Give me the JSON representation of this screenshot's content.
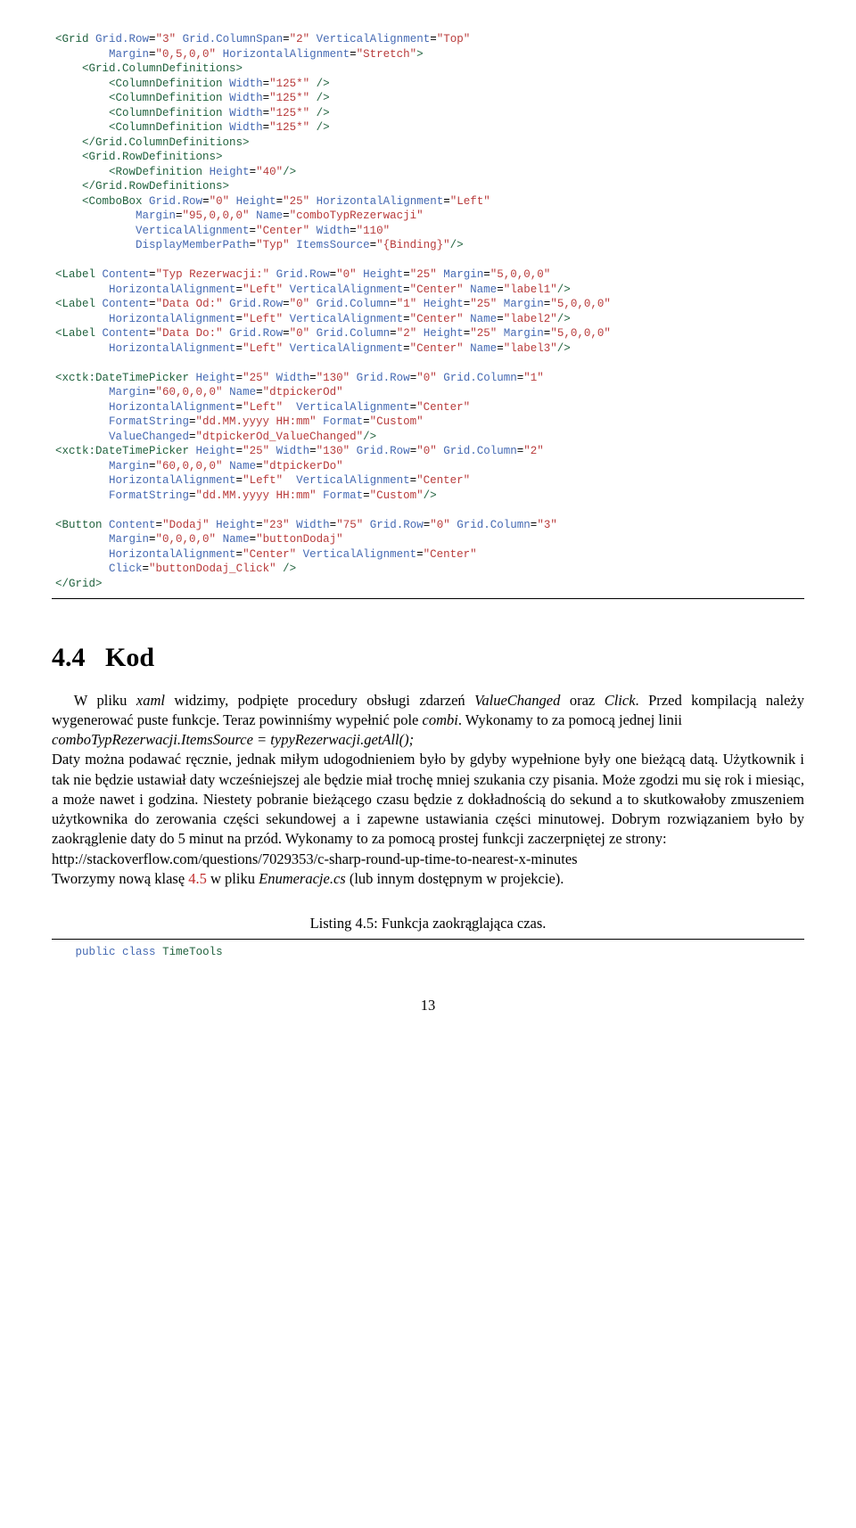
{
  "code1": {
    "l1a": "<Grid",
    "l1b": "Grid.Row",
    "l1c": "\"3\"",
    "l1d": "Grid.ColumnSpan",
    "l1e": "\"2\"",
    "l1f": "VerticalAlignment",
    "l1g": "\"Top\"",
    "l2a": "Margin",
    "l2b": "\"0,5,0,0\"",
    "l2c": "HorizontalAlignment",
    "l2d": "\"Stretch\"",
    "l2e": ">",
    "l3a": "<Grid.ColumnDefinitions>",
    "l4a": "<ColumnDefinition",
    "l4b": "Width",
    "l4c": "\"125*\"",
    "l4d": "/>",
    "l5a": "<ColumnDefinition",
    "l5b": "Width",
    "l5c": "\"125*\"",
    "l5d": "/>",
    "l6a": "<ColumnDefinition",
    "l6b": "Width",
    "l6c": "\"125*\"",
    "l6d": "/>",
    "l7a": "<ColumnDefinition",
    "l7b": "Width",
    "l7c": "\"125*\"",
    "l7d": "/>",
    "l8a": "</Grid.ColumnDefinitions>",
    "l9a": "<Grid.RowDefinitions>",
    "l10a": "<RowDefinition",
    "l10b": "Height",
    "l10c": "\"40\"",
    "l10d": "/>",
    "l11a": "</Grid.RowDefinitions>",
    "l12a": "<ComboBox",
    "l12b": "Grid.Row",
    "l12c": "\"0\"",
    "l12d": "Height",
    "l12e": "\"25\"",
    "l12f": "HorizontalAlignment",
    "l12g": "\"Left\"",
    "l13a": "Margin",
    "l13b": "\"95,0,0,0\"",
    "l13c": "Name",
    "l13d": "\"comboTypRezerwacji\"",
    "l14a": "VerticalAlignment",
    "l14b": "\"Center\"",
    "l14c": "Width",
    "l14d": "\"110\"",
    "l15a": "DisplayMemberPath",
    "l15b": "\"Typ\"",
    "l15c": "ItemsSource",
    "l15d": "\"{Binding}\"",
    "l15e": "/>",
    "l17a": "<Label",
    "l17b": "Content",
    "l17c": "\"Typ Rezerwacji:\"",
    "l17d": "Grid.Row",
    "l17e": "\"0\"",
    "l17f": "Height",
    "l17g": "\"25\"",
    "l17h": "Margin",
    "l17i": "\"5,0,0,0\"",
    "l18a": "HorizontalAlignment",
    "l18b": "\"Left\"",
    "l18c": "VerticalAlignment",
    "l18d": "\"Center\"",
    "l18e": "Name",
    "l18f": "\"label1\"",
    "l18g": "/>",
    "l19a": "<Label",
    "l19b": "Content",
    "l19c": "\"Data Od:\"",
    "l19d": "Grid.Row",
    "l19e": "\"0\"",
    "l19f": "Grid.Column",
    "l19g": "\"1\"",
    "l19h": "Height",
    "l19i": "\"25\"",
    "l19j": "Margin",
    "l19k": "\"5,0,0,0\"",
    "l20a": "HorizontalAlignment",
    "l20b": "\"Left\"",
    "l20c": "VerticalAlignment",
    "l20d": "\"Center\"",
    "l20e": "Name",
    "l20f": "\"label2\"",
    "l20g": "/>",
    "l21a": "<Label",
    "l21b": "Content",
    "l21c": "\"Data Do:\"",
    "l21d": "Grid.Row",
    "l21e": "\"0\"",
    "l21f": "Grid.Column",
    "l21g": "\"2\"",
    "l21h": "Height",
    "l21i": "\"25\"",
    "l21j": "Margin",
    "l21k": "\"5,0,0,0\"",
    "l22a": "HorizontalAlignment",
    "l22b": "\"Left\"",
    "l22c": "VerticalAlignment",
    "l22d": "\"Center\"",
    "l22e": "Name",
    "l22f": "\"label3\"",
    "l22g": "/>",
    "l24a": "<xctk:DateTimePicker",
    "l24b": "Height",
    "l24c": "\"25\"",
    "l24d": "Width",
    "l24e": "\"130\"",
    "l24f": "Grid.Row",
    "l24g": "\"0\"",
    "l24h": "Grid.Column",
    "l24i": "\"1\"",
    "l25a": "Margin",
    "l25b": "\"60,0,0,0\"",
    "l25c": "Name",
    "l25d": "\"dtpickerOd\"",
    "l26a": "HorizontalAlignment",
    "l26b": "\"Left\"",
    "l26c": "VerticalAlignment",
    "l26d": "\"Center\"",
    "l27a": "FormatString",
    "l27b": "\"dd.MM.yyyy HH:mm\"",
    "l27c": "Format",
    "l27d": "\"Custom\"",
    "l28a": "ValueChanged",
    "l28b": "\"dtpickerOd_ValueChanged\"",
    "l28c": "/>",
    "l29a": "<xctk:DateTimePicker",
    "l29b": "Height",
    "l29c": "\"25\"",
    "l29d": "Width",
    "l29e": "\"130\"",
    "l29f": "Grid.Row",
    "l29g": "\"0\"",
    "l29h": "Grid.Column",
    "l29i": "\"2\"",
    "l30a": "Margin",
    "l30b": "\"60,0,0,0\"",
    "l30c": "Name",
    "l30d": "\"dtpickerDo\"",
    "l31a": "HorizontalAlignment",
    "l31b": "\"Left\"",
    "l31c": "VerticalAlignment",
    "l31d": "\"Center\"",
    "l32a": "FormatString",
    "l32b": "\"dd.MM.yyyy HH:mm\"",
    "l32c": "Format",
    "l32d": "\"Custom\"",
    "l32e": "/>",
    "l34a": "<Button",
    "l34b": "Content",
    "l34c": "\"Dodaj\"",
    "l34d": "Height",
    "l34e": "\"23\"",
    "l34f": "Width",
    "l34g": "\"75\"",
    "l34h": "Grid.Row",
    "l34i": "\"0\"",
    "l34j": "Grid.Column",
    "l34k": "\"3\"",
    "l35a": "Margin",
    "l35b": "\"0,0,0,0\"",
    "l35c": "Name",
    "l35d": "\"buttonDodaj\"",
    "l36a": "HorizontalAlignment",
    "l36b": "\"Center\"",
    "l36c": "VerticalAlignment",
    "l36d": "\"Center\"",
    "l37a": "Click",
    "l37b": "\"buttonDodaj_Click\"",
    "l37c": "/>",
    "l38a": "</Grid>"
  },
  "section": {
    "number": "4.4",
    "title": "Kod"
  },
  "body": {
    "p1a": "W pliku ",
    "p1b": "xaml",
    "p1c": " widzimy, podpięte procedury obsługi zdarzeń ",
    "p1d": "ValueChanged",
    "p1e": " oraz ",
    "p1f": "Click",
    "p1g": ". Przed kompilacją należy wygenerować puste funkcje. Teraz powinniśmy wypełnić pole ",
    "p1h": "combi",
    "p1i": ". Wykonamy to za pomocą jednej linii",
    "p2": "comboTypRezerwacji.ItemsSource = typyRezerwacji.getAll();",
    "p3": "Daty można podawać ręcznie, jednak miłym udogodnieniem było by gdyby wypełnione były one bieżącą datą. Użytkownik i tak nie będzie ustawiał daty wcześniejszej ale będzie miał trochę mniej szukania czy pisania. Może zgodzi mu się rok i miesiąc, a może nawet i godzina. Niestety pobranie bieżącego czasu będzie z dokładnością do sekund a to skutkowałoby zmuszeniem użytkownika do zerowania części sekundowej a i zapewne ustawiania części minutowej. Dobrym rozwiązaniem było by zaokrąglenie daty do 5 minut na przód. Wykonamy to za pomocą prostej funkcji zaczerpniętej ze strony:",
    "p4": "http://stackoverflow.com/questions/7029353/c-sharp-round-up-time-to-nearest-x-minutes",
    "p5a": "Tworzymy nową klasę ",
    "p5b": "4.5",
    "p5c": " w pliku ",
    "p5d": "Enumeracje.cs",
    "p5e": "   (lub innym dostępnym w projekcie)."
  },
  "listing": {
    "caption": "Listing 4.5: Funkcja zaokrąglająca czas.",
    "kw1": "public",
    "kw2": "class",
    "cn": "TimeTools"
  },
  "pagenum": "13"
}
